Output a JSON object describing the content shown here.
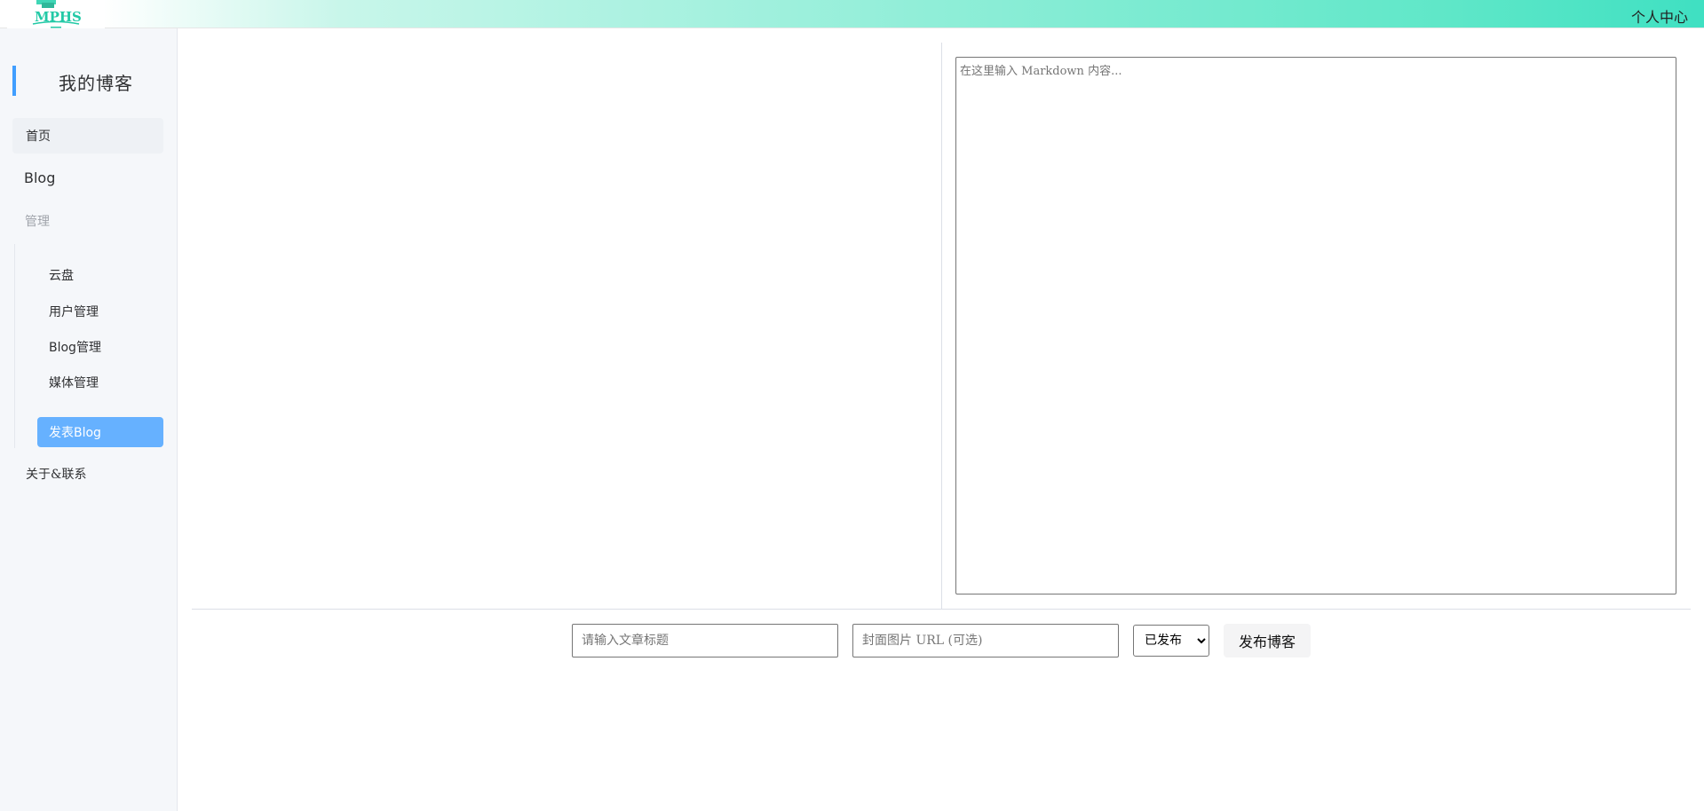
{
  "header": {
    "logo_text": "MPHS",
    "user_center": "个人中心"
  },
  "sidebar": {
    "brand_title": "我的博客",
    "items": [
      {
        "label": "首页"
      },
      {
        "label": "Blog"
      },
      {
        "label": "管理"
      },
      {
        "label": "关于&联系"
      }
    ],
    "submenu": [
      {
        "label": "云盘"
      },
      {
        "label": "用户管理"
      },
      {
        "label": "Blog管理"
      },
      {
        "label": "媒体管理"
      },
      {
        "label": "发表Blog",
        "active": true
      }
    ]
  },
  "editor": {
    "markdown_placeholder": "在这里输入 Markdown 内容...",
    "markdown_value": ""
  },
  "publish_bar": {
    "title_placeholder": "请输入文章标题",
    "title_value": "",
    "cover_placeholder": "封面图片 URL (可选)",
    "cover_value": "",
    "status_selected": "已发布",
    "publish_button": "发布博客"
  },
  "colors": {
    "accent": "#409eff",
    "active_item_bg": "#66b1ff",
    "header_gradient_end": "#3fe0c2"
  }
}
